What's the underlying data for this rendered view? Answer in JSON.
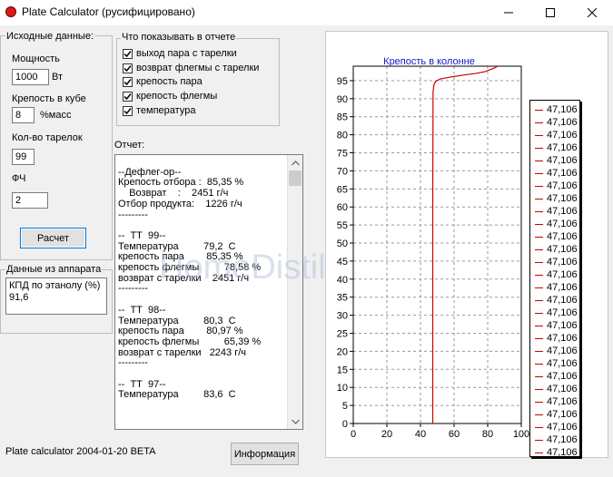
{
  "window": {
    "title": "Plate Calculator (русифицировано)"
  },
  "input_group": {
    "title": "Исходные данные:",
    "power_label": "Мощность",
    "power_value": "1000",
    "power_unit": "Вт",
    "strength_label": "Крепость в кубе",
    "strength_value": "8",
    "strength_unit": "%масс",
    "plates_label": "Кол-во тарелок",
    "plates_value": "99",
    "fch_label": "ФЧ",
    "fch_value": "2",
    "calc_button": "Расчет"
  },
  "apparatus_group": {
    "title": "Данные из аппарата",
    "efficiency_lines": "КПД по этанолу (%)\n91,6"
  },
  "report_options": {
    "title": "Что показывать в отчете",
    "items": [
      {
        "label": "выход пара с тарелки",
        "checked": true
      },
      {
        "label": "возврат флегмы с тарелки",
        "checked": true
      },
      {
        "label": "крепость пара",
        "checked": true
      },
      {
        "label": "крепость флегмы",
        "checked": true
      },
      {
        "label": "температура",
        "checked": true
      }
    ]
  },
  "report": {
    "label": "Отчет:",
    "text": "\n--Дефлег-ор--\nКрепость отбора :  85,35 %\n    Возврат    :    2451 г/ч\nОтбор продукта:    1226 г/ч\n---------\n\n--  ТТ  99--\nТемпература         79,2  С\nкрепость пара        85,35 %\nкрепость флегмы         78,58 %\nвозврат с тарелки    2451 г/ч\n---------\n\n--  ТТ  98--\nТемпература         80,3  С\nкрепость пара        80,97 %\nкрепость флегмы         65,39 %\nвозврат с тарелки   2243 г/ч\n---------\n\n--  ТТ  97--\nТемпература         83,6  С"
  },
  "footer": {
    "version": "Plate calculator 2004-01-20 BETA",
    "info_button": "Информация"
  },
  "watermark": "HomeDistiller.ru",
  "chart_data": {
    "type": "line",
    "title": "Крепость в колонне",
    "xlabel": "",
    "ylabel": "",
    "xlim": [
      0,
      100
    ],
    "ylim": [
      0,
      99
    ],
    "xticks": [
      0,
      20,
      40,
      60,
      80,
      100
    ],
    "yticks": [
      0,
      5,
      10,
      15,
      20,
      25,
      30,
      35,
      40,
      45,
      50,
      55,
      60,
      65,
      70,
      75,
      80,
      85,
      90,
      95
    ],
    "grid": true,
    "line_color": "#cc0000",
    "series": [
      {
        "x": [
          47.3,
          47.3,
          47.3,
          47.5,
          48,
          49,
          52,
          58,
          65,
          73,
          78.6,
          84,
          86
        ],
        "y": [
          0,
          20,
          60,
          92,
          93.8,
          94.8,
          95.5,
          96,
          96.5,
          97,
          97.5,
          98.5,
          99
        ]
      }
    ],
    "legend": {
      "position": "right",
      "entry_symbol": "line",
      "entries": [
        "47,106",
        "47,106",
        "47,106",
        "47,106",
        "47,106",
        "47,106",
        "47,106",
        "47,106",
        "47,106",
        "47,106",
        "47,106",
        "47,106",
        "47,106",
        "47,106",
        "47,106",
        "47,106",
        "47,106",
        "47,106",
        "47,106",
        "47,106",
        "47,106",
        "47,106",
        "47,106",
        "47,106",
        "47,106",
        "47,106",
        "47,106",
        "47,106"
      ]
    }
  }
}
